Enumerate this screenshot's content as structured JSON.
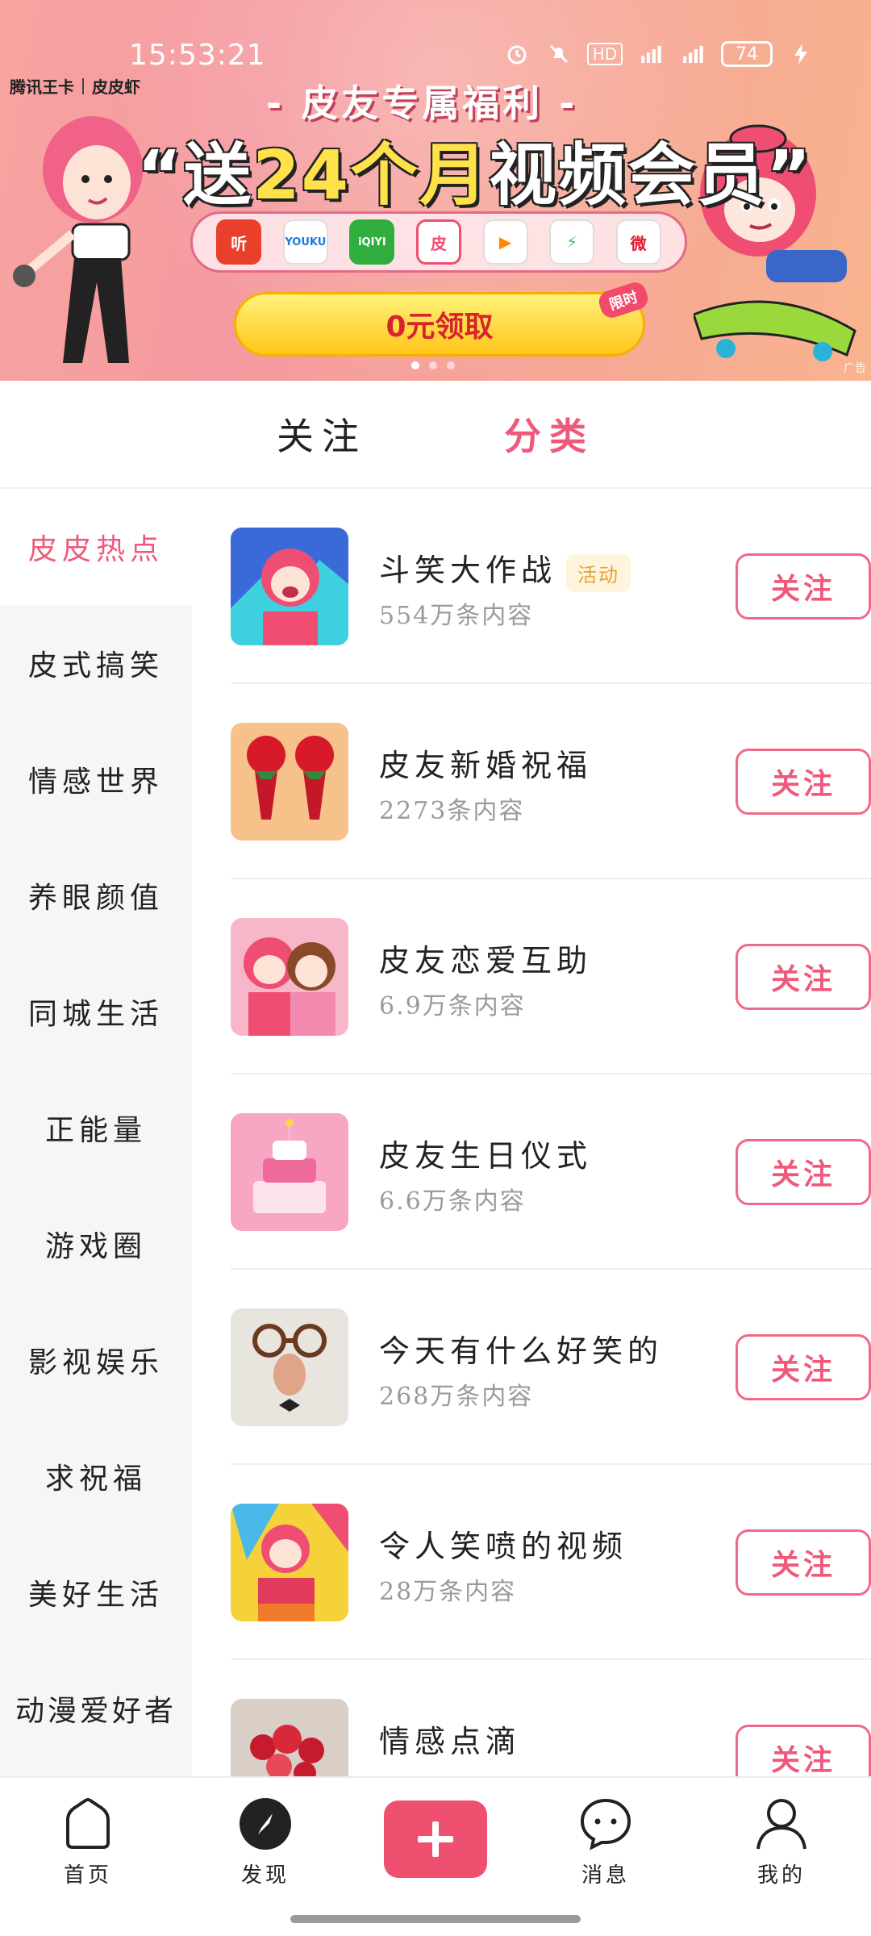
{
  "status_bar": {
    "time": "15:53:21",
    "battery": "74",
    "network": "4G",
    "network2": "5G",
    "hd": "HD"
  },
  "banner": {
    "brand_left": "腾讯王卡",
    "brand_right": "皮皮虾",
    "subtitle": "- 皮友专属福利 -",
    "title_prefix": "“送",
    "title_highlight": "24个月",
    "title_suffix": "视频会员”",
    "cta_label": "0元领取",
    "cta_tag": "限时",
    "ad_label": "广告",
    "apps": [
      {
        "icon": "tingshu-icon",
        "label": "听",
        "color": "#e8402a"
      },
      {
        "icon": "youku-icon",
        "label": "YOUKU",
        "color": "#ffffff"
      },
      {
        "icon": "iqiyi-icon",
        "label": "iQIYI",
        "color": "#2fae3e"
      },
      {
        "icon": "pipixia-icon",
        "label": "皮",
        "color": "#ffffff"
      },
      {
        "icon": "tencent-video-icon",
        "label": "▶",
        "color": "#ffffff"
      },
      {
        "icon": "speed-icon",
        "label": "⚡",
        "color": "#ffffff"
      },
      {
        "icon": "weibo-icon",
        "label": "微",
        "color": "#ffffff"
      }
    ]
  },
  "top_tabs": [
    {
      "label": "关注",
      "active": false
    },
    {
      "label": "分类",
      "active": true
    }
  ],
  "sidebar": {
    "items": [
      {
        "label": "皮皮热点",
        "active": true
      },
      {
        "label": "皮式搞笑",
        "active": false
      },
      {
        "label": "情感世界",
        "active": false
      },
      {
        "label": "养眼颜值",
        "active": false
      },
      {
        "label": "同城生活",
        "active": false
      },
      {
        "label": "正能量",
        "active": false
      },
      {
        "label": "游戏圈",
        "active": false
      },
      {
        "label": "影视娱乐",
        "active": false
      },
      {
        "label": "求祝福",
        "active": false
      },
      {
        "label": "美好生活",
        "active": false
      },
      {
        "label": "动漫爱好者",
        "active": false
      }
    ]
  },
  "list": {
    "follow_label": "关注",
    "items": [
      {
        "title": "斗笑大作战",
        "badge": "活动",
        "count": "554万条内容",
        "thumb": "cartoon-mascot-thumbnail"
      },
      {
        "title": "皮友新婚祝福",
        "badge": "",
        "count": "2273条内容",
        "thumb": "wedding-roses-thumbnail"
      },
      {
        "title": "皮友恋爱互助",
        "badge": "",
        "count": "6.9万条内容",
        "thumb": "couple-cartoon-thumbnail"
      },
      {
        "title": "皮友生日仪式",
        "badge": "",
        "count": "6.6万条内容",
        "thumb": "birthday-cake-thumbnail"
      },
      {
        "title": "今天有什么好笑的",
        "badge": "",
        "count": "268万条内容",
        "thumb": "funny-face-thumbnail"
      },
      {
        "title": "令人笑喷的视频",
        "badge": "",
        "count": "28万条内容",
        "thumb": "laughing-mascot-thumbnail"
      },
      {
        "title": "情感点滴",
        "badge": "",
        "count": "",
        "thumb": "flower-bouquet-thumbnail"
      }
    ]
  },
  "bottom_nav": {
    "items": [
      {
        "label": "首页",
        "icon": "home-icon"
      },
      {
        "label": "发现",
        "icon": "compass-icon"
      },
      {
        "label": "",
        "icon": "plus-icon"
      },
      {
        "label": "消息",
        "icon": "message-icon"
      },
      {
        "label": "我的",
        "icon": "profile-icon"
      }
    ]
  },
  "colors": {
    "accent": "#ef5a7c",
    "badge_text": "#e8a13a",
    "badge_bg": "#fff4dc",
    "sidebar_bg": "#f6f6f6"
  }
}
